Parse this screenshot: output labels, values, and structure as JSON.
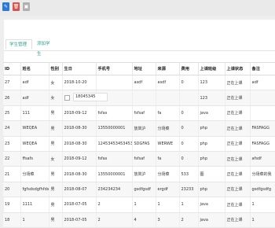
{
  "toolbar": {
    "buttons": [
      {
        "label": "✎",
        "icon": "pencil-icon"
      },
      {
        "label": "🗑",
        "icon": "trash-icon"
      },
      {
        "label": "▣",
        "icon": "restore-icon"
      }
    ]
  },
  "tabs": [
    {
      "label": "学生管理",
      "active": true
    },
    {
      "label": "添加学生",
      "active": false
    }
  ],
  "table": {
    "columns": [
      "ID",
      "姓名",
      "性别",
      "生日",
      "手机号",
      "地址",
      "来源",
      "费用",
      "上课班级",
      "上课状态",
      "备注"
    ],
    "rows": [
      [
        "27",
        "adf",
        "女",
        "2018-10-20",
        "",
        "asdf",
        "asdf",
        "0",
        "123",
        "正在上课",
        "adf"
      ],
      [
        "26",
        "adf",
        "女",
        "",
        "",
        "",
        "",
        "",
        "123",
        "正在上课",
        ""
      ],
      [
        "25",
        "111",
        "男",
        "2018-09-12",
        "fsfas",
        "fsfsaf",
        "fa",
        "0",
        "java",
        "正在上课",
        ""
      ],
      [
        "24",
        "WEQEA",
        "男",
        "2018-08-30",
        "13550000001",
        "放岚沪",
        "分场菜",
        "0",
        "php",
        "正在上课",
        "FASFAGG"
      ],
      [
        "23",
        "WEQEA",
        "男",
        "2018-08-30",
        "12453453453453",
        "SDGFAS",
        "WERWE",
        "0",
        "php",
        "正在上课",
        "FASFAGG"
      ],
      [
        "22",
        "ffsafs",
        "女",
        "2018-09-12",
        "fsfas",
        "fsfsaf",
        "fa",
        "0",
        "php",
        "正在上课",
        "afsdf"
      ],
      [
        "21",
        "分场菜",
        "男",
        "2018-08-30",
        "13550000001",
        "放岚沪",
        "分场菜",
        "533",
        "图",
        "正在上课",
        "分场菜的我"
      ],
      [
        "20",
        "fgfsdsdgfhfds",
        "男",
        "2018-08-07",
        "234234234",
        "gsdfgsdf",
        "ergdf",
        "23233",
        "php",
        "正在上课",
        "gsdfgsdfg"
      ],
      [
        "19",
        "1111",
        "男",
        "2018-07-05",
        "2",
        "1",
        "1",
        "1",
        "java",
        "正在上课",
        "1"
      ],
      [
        "18",
        "1",
        "男",
        "2018-07-05",
        "2",
        "4",
        "3",
        "2",
        "java",
        "正在上课",
        "1"
      ]
    ]
  },
  "floating_edit_value": "18045345"
}
